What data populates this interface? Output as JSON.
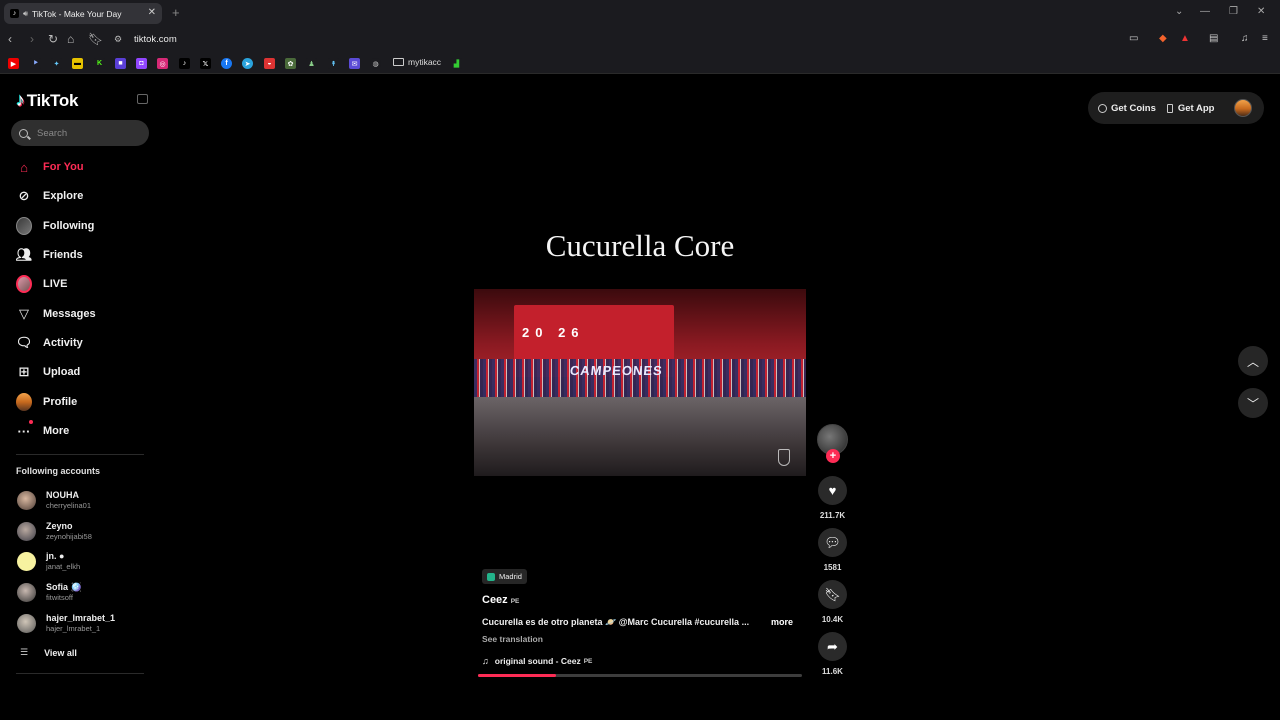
{
  "browser": {
    "tab_title": "TikTok - Make Your Day",
    "url": "tiktok.com",
    "bookmark_folder": "mytikacc"
  },
  "sidebar": {
    "logo": "TikTok",
    "search_placeholder": "Search",
    "nav": [
      {
        "label": "For You",
        "icon": "home-icon",
        "active": true
      },
      {
        "label": "Explore",
        "icon": "compass-icon"
      },
      {
        "label": "Following",
        "icon": "following-avatar-icon"
      },
      {
        "label": "Friends",
        "icon": "friends-icon"
      },
      {
        "label": "LIVE",
        "icon": "live-avatar-icon"
      },
      {
        "label": "Messages",
        "icon": "send-icon"
      },
      {
        "label": "Activity",
        "icon": "activity-icon"
      },
      {
        "label": "Upload",
        "icon": "upload-icon"
      },
      {
        "label": "Profile",
        "icon": "profile-avatar-icon"
      },
      {
        "label": "More",
        "icon": "more-dots-icon"
      }
    ],
    "following_title": "Following accounts",
    "following": [
      {
        "name": "NOUHA",
        "username": "cherryelina01"
      },
      {
        "name": "Zeyno",
        "username": "zeynohijabi58"
      },
      {
        "name": "jn. ●",
        "username": "janat_elkh"
      },
      {
        "name": "Sofia 🪩",
        "username": "fitwitsoff"
      },
      {
        "name": "hajer_lmrabet_1",
        "username": "hajer_lmrabet_1"
      }
    ],
    "view_all": "View all"
  },
  "header": {
    "get_coins": "Get Coins",
    "get_app": "Get App"
  },
  "video": {
    "title": "Cucurella Core",
    "location": "Madrid",
    "author": "Ceez",
    "author_tag": "PE",
    "caption": "Cucurella es de otro planeta 🪐 @Marc Cucurella #cucurella ...",
    "more": "more",
    "see_translation": "See translation",
    "sound": "original sound - Ceez",
    "sound_tag": "PE",
    "frame_year": "20 26",
    "frame_banner": "CAMPEONES",
    "progress": 0.24
  },
  "actions": {
    "likes": "211.7K",
    "comments": "1581",
    "saves": "10.4K",
    "shares": "11.6K"
  }
}
